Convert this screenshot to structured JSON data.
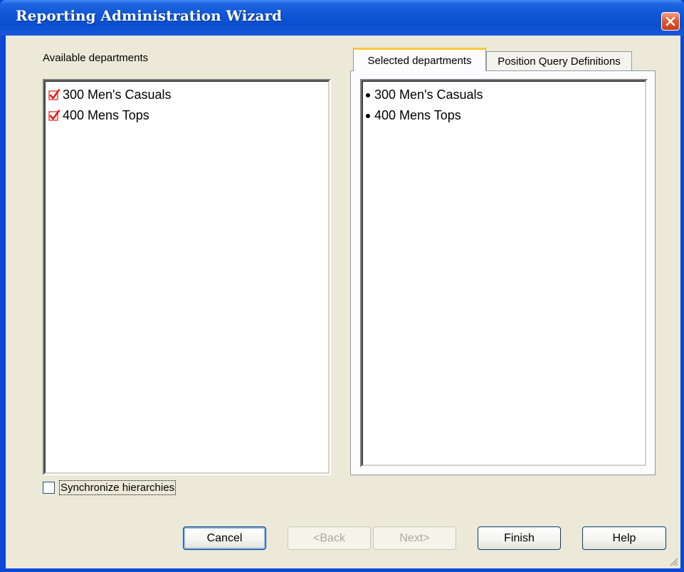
{
  "window": {
    "title": "Reporting Administration Wizard",
    "close_icon": "close-icon"
  },
  "available": {
    "label": "Available departments",
    "items": [
      {
        "label": "300 Men's Casuals",
        "checked": true
      },
      {
        "label": "400 Mens Tops",
        "checked": true
      }
    ]
  },
  "tabs": [
    {
      "label": "Selected departments",
      "active": true
    },
    {
      "label": "Position Query Definitions",
      "active": false
    }
  ],
  "selected": {
    "items": [
      {
        "label": "300 Men's Casuals"
      },
      {
        "label": "400 Mens Tops"
      }
    ]
  },
  "sync": {
    "label": "Synchronize hierarchies",
    "checked": false
  },
  "buttons": {
    "cancel": "Cancel",
    "back": "<Back",
    "next": "Next>",
    "finish": "Finish",
    "help": "Help"
  },
  "colors": {
    "title_bar": "#0a4fd0",
    "dialog_bg": "#ece9d8",
    "check_mark": "#e0201a",
    "active_tab_accent": "#ffc83c"
  }
}
